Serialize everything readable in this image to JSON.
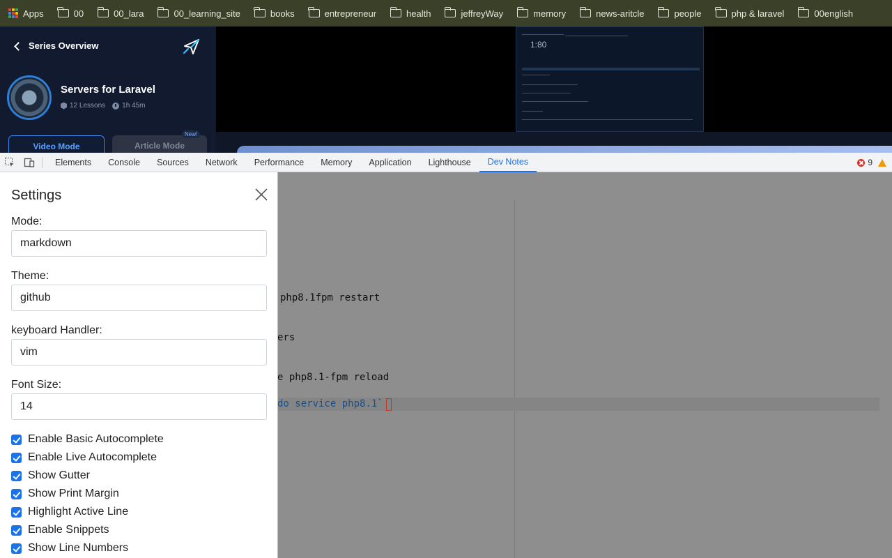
{
  "bookmarks": {
    "apps_label": "Apps",
    "folders": [
      "00",
      "00_lara",
      "00_learning_site",
      "books",
      "entrepreneur",
      "health",
      "jeffreyWay",
      "memory",
      "news-aritcle",
      "people",
      "php & laravel",
      "00english"
    ]
  },
  "series": {
    "back_label": "Series Overview",
    "title": "Servers for Laravel",
    "lessons": "12 Lessons",
    "duration": "1h 45m",
    "video_mode_label": "Video Mode",
    "article_mode_label": "Article Mode",
    "new_badge": "New!"
  },
  "video": {
    "time_overlay": "1:80"
  },
  "devtools": {
    "tabs": [
      "Elements",
      "Console",
      "Sources",
      "Network",
      "Performance",
      "Memory",
      "Application",
      "Lighthouse",
      "Dev Notes"
    ],
    "active_tab": "Dev Notes",
    "error_count": "9",
    "colors": {
      "accent": "#1a73e8",
      "error": "#d93025",
      "warning": "#f29900"
    }
  },
  "editor": {
    "lines": [
      {
        "text": "php8.1fpm restart",
        "style": "plain"
      },
      {
        "text": "ers",
        "style": "plain"
      },
      {
        "text": "e php8.1-fpm reload",
        "style": "plain"
      },
      {
        "text": "do service php8.1`",
        "style": "blue"
      }
    ]
  },
  "settings": {
    "title": "Settings",
    "mode_label": "Mode:",
    "mode_value": "markdown",
    "theme_label": "Theme:",
    "theme_value": "github",
    "keyboard_label": "keyboard Handler:",
    "keyboard_value": "vim",
    "font_size_label": "Font Size:",
    "font_size_value": "14",
    "checkboxes": [
      "Enable Basic Autocomplete",
      "Enable Live Autocomplete",
      "Show Gutter",
      "Show Print Margin",
      "Highlight Active Line",
      "Enable Snippets",
      "Show Line Numbers"
    ]
  }
}
